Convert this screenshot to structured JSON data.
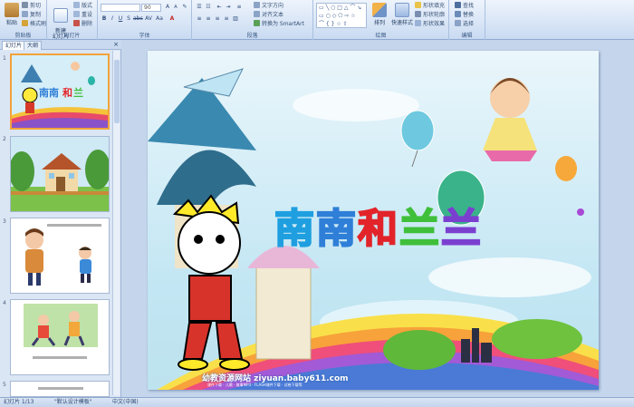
{
  "ribbon": {
    "clipboard": {
      "label": "剪贴板",
      "paste": "粘贴",
      "cut": "剪切",
      "copy": "复制",
      "format_painter": "格式刷"
    },
    "slides": {
      "label": "幻灯片",
      "new_slide": "新建\n幻灯片",
      "layout": "版式",
      "reset": "重设",
      "delete": "删除"
    },
    "font": {
      "label": "字体",
      "font_size": "90"
    },
    "paragraph": {
      "label": "段落",
      "text_direction": "文字方向",
      "align_text": "对齐文本",
      "smartart": "转换为 SmartArt"
    },
    "drawing": {
      "label": "绘图",
      "arrange": "排列",
      "quick_styles": "快速样式",
      "shape_fill": "形状填充",
      "shape_outline": "形状轮廓",
      "shape_effects": "形状效果"
    },
    "editing": {
      "label": "编辑",
      "find": "查找",
      "replace": "替换",
      "select": "选择"
    }
  },
  "panel": {
    "tabs": {
      "slides": "幻灯片",
      "outline": "大纲"
    },
    "close": "×",
    "thumbnails": [
      {
        "num": "1"
      },
      {
        "num": "2"
      },
      {
        "num": "3"
      },
      {
        "num": "4"
      },
      {
        "num": "5"
      }
    ]
  },
  "slide": {
    "title_chars": [
      "南",
      "南",
      "和",
      "兰",
      "兰"
    ],
    "site_line1": "幼教资源网站 ziyuan.baby611.com",
    "site_line2": "课件下载 · 儿歌 · 故事MP3 · FLASH课件下载 · 试卷下载等"
  },
  "statusbar": {
    "slide_count": "幻灯片 1/13",
    "theme": "\"默认设计模板\"",
    "language": "中文(中国)"
  },
  "colors": {
    "title_blue": "#1f9fe0",
    "title_red": "#e2242a",
    "title_green": "#3fbf3a",
    "title_purple": "#7b3fd0",
    "selection": "#f2a33a"
  }
}
